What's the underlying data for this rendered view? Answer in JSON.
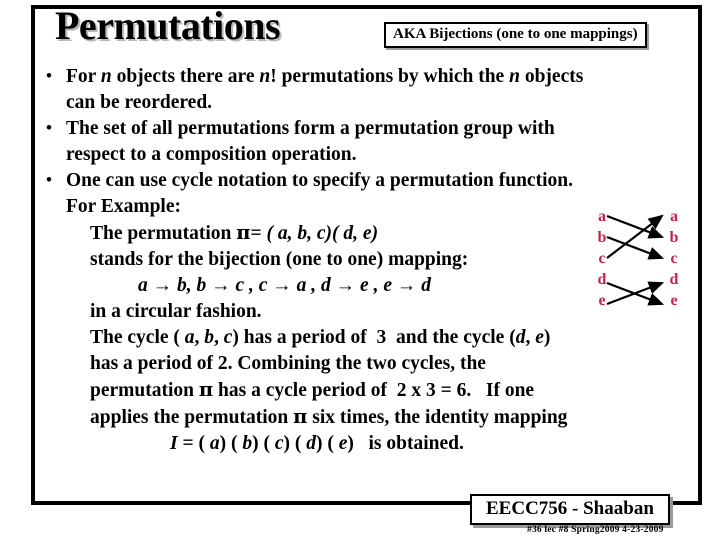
{
  "slide": {
    "title": "Permutations",
    "aka_badge": "AKA Bijections (one to one mappings)",
    "accent_color": "#C8234A",
    "frame_color": "#000000",
    "bullets": [
      {
        "lines": [
          "For n objects there are n! permutations by which the n objects",
          "can be reordered."
        ]
      },
      {
        "lines": [
          "The set of all permutations form a permutation group with",
          "respect to a composition operation."
        ]
      },
      {
        "lines": [
          "One can use cycle notation to specify a permutation function."
        ]
      }
    ],
    "example": {
      "heading": "For Example:",
      "line_permutation_label": "The permutation",
      "pi_symbol": "π",
      "equals": "=",
      "cycle_notation": "( a, b, c)( d, e)",
      "line_stands_for": "stands for the bijection (one to one) mapping:",
      "mapping_list": "a → b,   b → c ,  c → a ,  d → e ,  e → d",
      "line_circular": "in a circular  fashion.",
      "line_cycle_period_a": "The cycle ( a, b, c) has a period of  3  and the cycle (d, e)",
      "line_cycle_period_b": "has a period of 2.    Combining the two cycles, the",
      "line_cycle_period_c": "permutation π has a cycle period of  2 x 3 = 6.   If one",
      "line_cycle_period_d": "applies the permutation π six times, the identity mapping",
      "line_identity": "I = ( a) ( b) ( c) ( d) ( e)   is obtained."
    },
    "diagram": {
      "left_labels": [
        "a",
        "b",
        "c",
        "d",
        "e"
      ],
      "right_labels": [
        "a",
        "b",
        "c",
        "d",
        "e"
      ],
      "arrows": [
        {
          "from": "a",
          "to": "b"
        },
        {
          "from": "b",
          "to": "c"
        },
        {
          "from": "c",
          "to": "a"
        },
        {
          "from": "d",
          "to": "e"
        },
        {
          "from": "e",
          "to": "d"
        }
      ]
    },
    "footer": {
      "badge": "EECC756 - Shaaban",
      "meta": "#36  lec #8    Spring2009  4-23-2009"
    }
  }
}
